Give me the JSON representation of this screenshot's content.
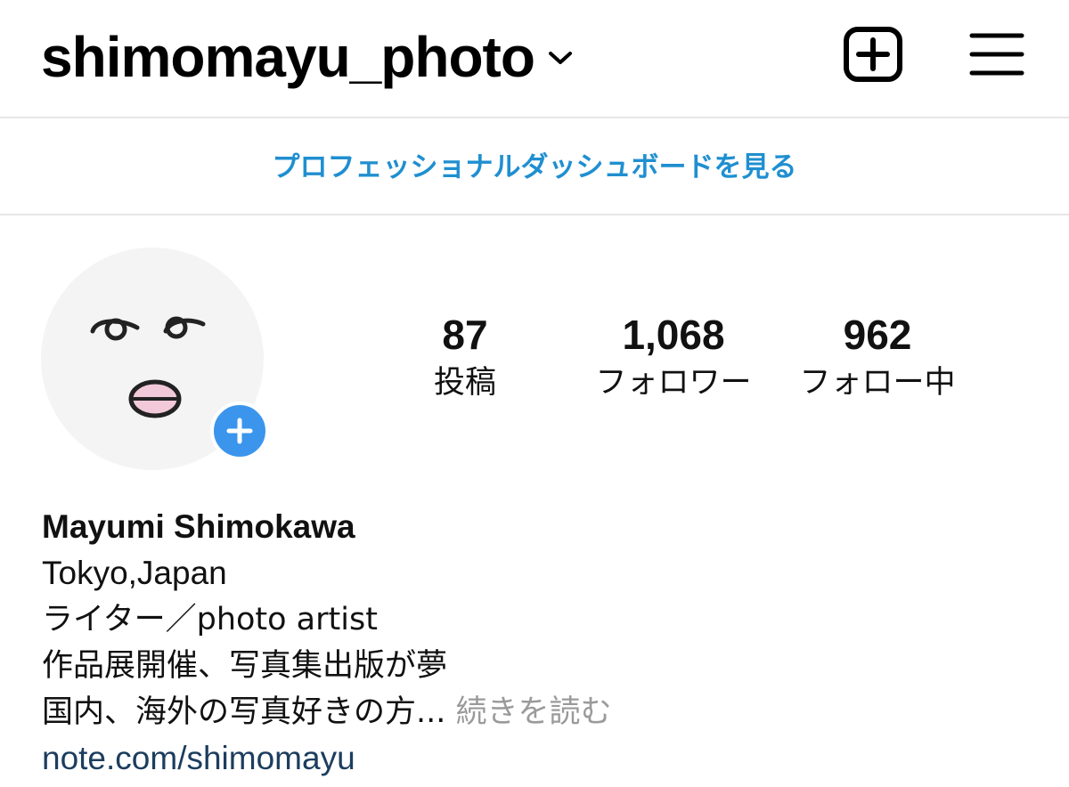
{
  "header": {
    "username": "shimomayu_photo"
  },
  "dashboard": {
    "link_text": "プロフェッショナルダッシュボードを見る"
  },
  "stats": {
    "posts": {
      "count": "87",
      "label": "投稿"
    },
    "followers": {
      "count": "1,068",
      "label": "フォロワー"
    },
    "following": {
      "count": "962",
      "label": "フォロー中"
    }
  },
  "bio": {
    "name": "Mayumi Shimokawa",
    "line1": "Tokyo,Japan",
    "line2": "ライター／photo artist",
    "line3": "作品展開催、写真集出版が夢",
    "line4": "国内、海外の写真好きの方...",
    "more": "続きを読む",
    "link": "note.com/shimomayu"
  },
  "icons": {
    "dropdown": "chevron-down-icon",
    "new_post": "plus-square-icon",
    "menu": "hamburger-menu-icon",
    "add_story": "plus-icon"
  },
  "colors": {
    "link_blue": "#1f8fd0",
    "story_blue": "#3b95ec",
    "muted": "#9a9a9a",
    "bio_link": "#1c3d5e"
  }
}
